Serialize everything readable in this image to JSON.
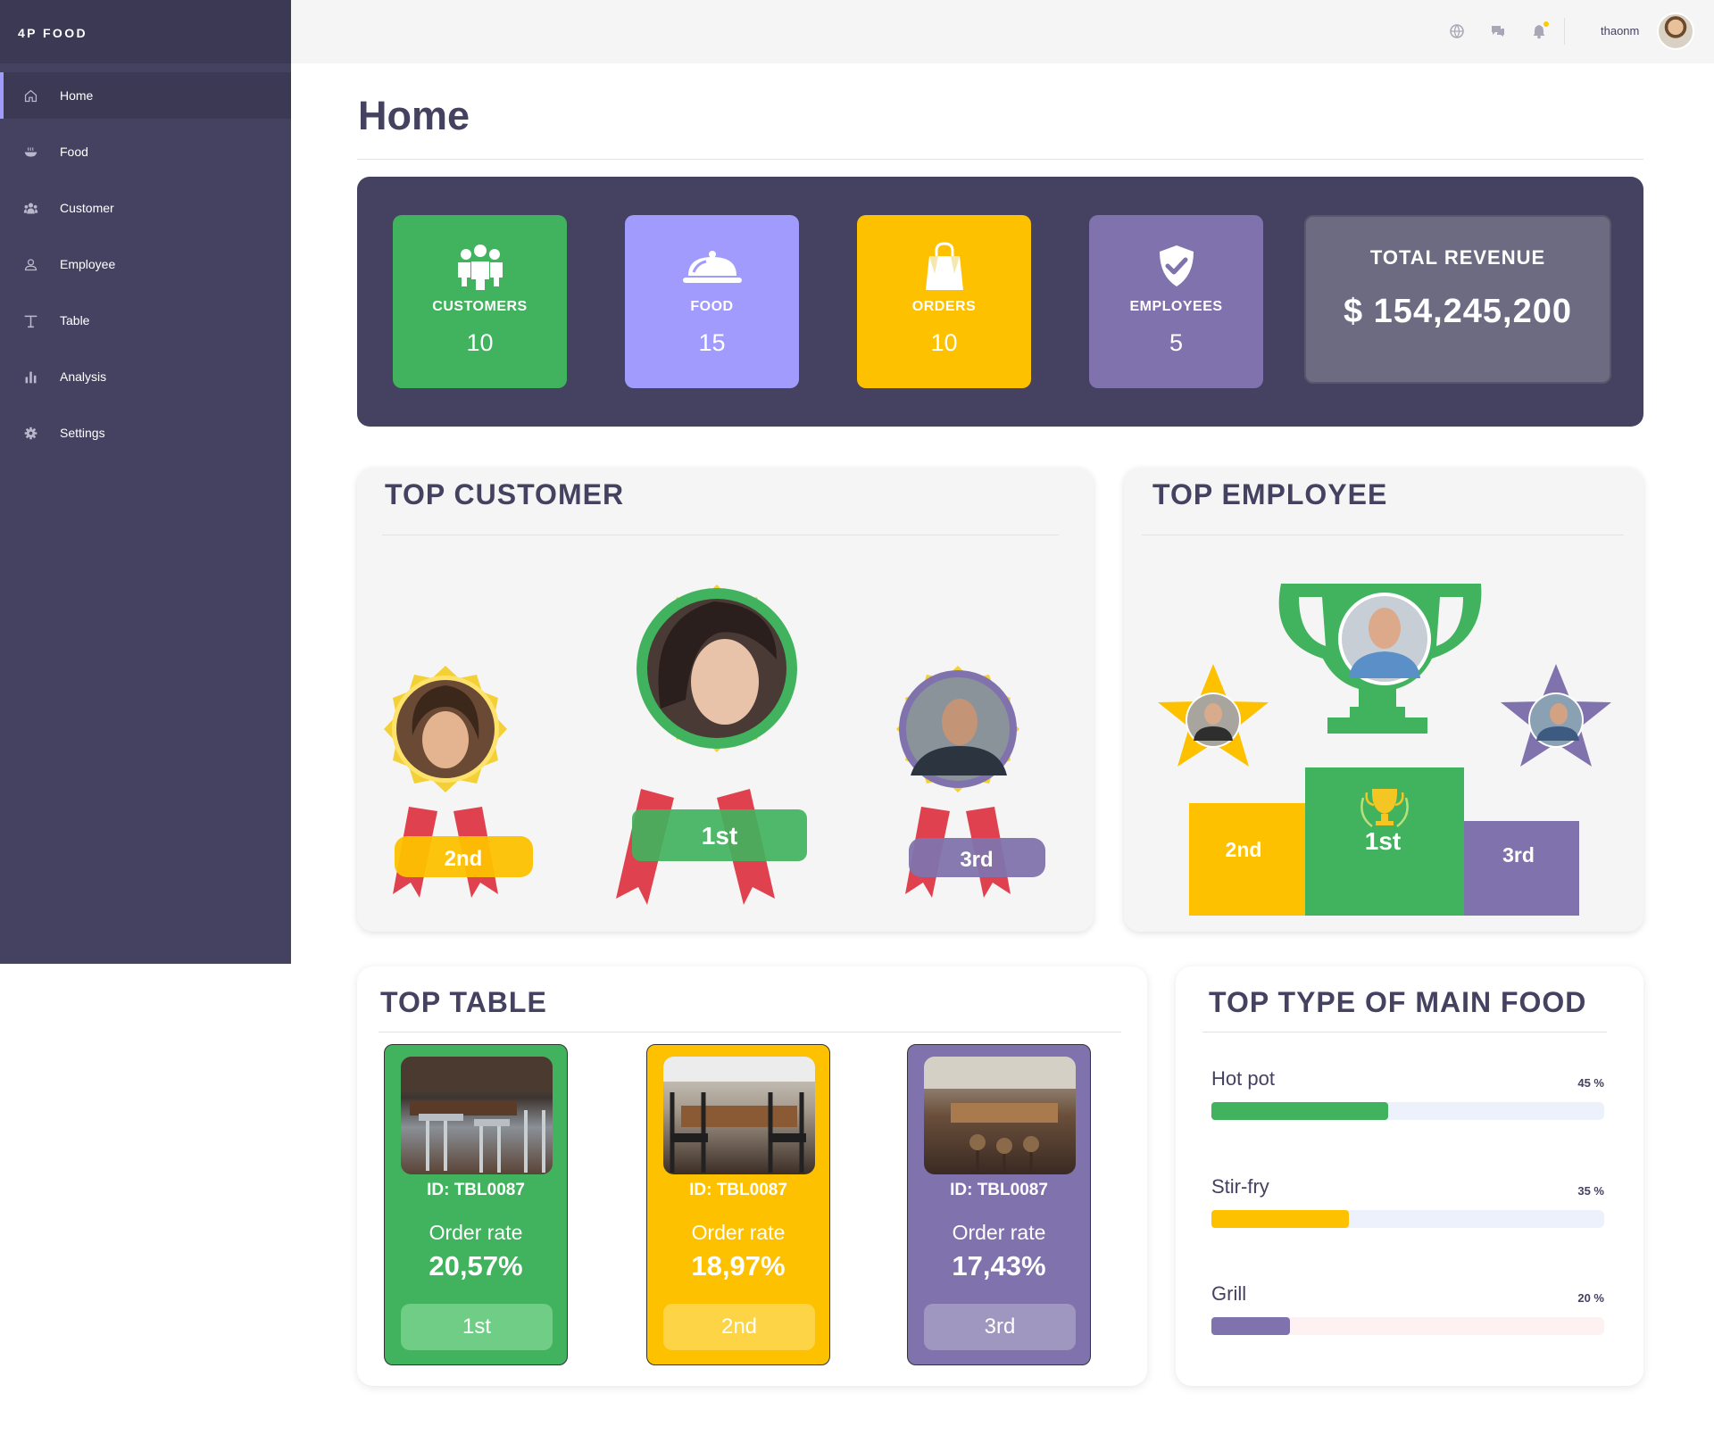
{
  "app": {
    "brand": "4P FOOD"
  },
  "sidebar": {
    "items": [
      {
        "label": "Home",
        "icon": "home-icon",
        "active": true
      },
      {
        "label": "Food",
        "icon": "bowl-icon"
      },
      {
        "label": "Customer",
        "icon": "users-icon"
      },
      {
        "label": "Employee",
        "icon": "user-icon"
      },
      {
        "label": "Table",
        "icon": "table-icon"
      },
      {
        "label": "Analysis",
        "icon": "bar-chart-icon"
      },
      {
        "label": "Settings",
        "icon": "gear-icon"
      }
    ]
  },
  "topbar": {
    "icons": [
      "globe-icon",
      "chat-icon",
      "bell-icon"
    ],
    "username": "thaonm"
  },
  "page": {
    "title": "Home"
  },
  "stats": {
    "customers": {
      "label": "CUSTOMERS",
      "value": "10",
      "icon": "users-icon",
      "color": "#41b25d"
    },
    "food": {
      "label": "FOOD",
      "value": "15",
      "icon": "cloche-icon",
      "color": "#a29bfe"
    },
    "orders": {
      "label": "ORDERS",
      "value": "10",
      "icon": "shopping-bag-icon",
      "color": "#fdc100"
    },
    "employees": {
      "label": "EMPLOYEES",
      "value": "5",
      "icon": "shield-check-icon",
      "color": "#8073ad"
    },
    "revenue": {
      "label": "TOTAL REVENUE",
      "value": "$ 154,245,200"
    }
  },
  "top_customer": {
    "title": "TOP CUSTOMER",
    "ranks": {
      "first": "1st",
      "second": "2nd",
      "third": "3rd"
    }
  },
  "top_employee": {
    "title": "TOP EMPLOYEE",
    "ranks": {
      "first": "1st",
      "second": "2nd",
      "third": "3rd"
    }
  },
  "top_table": {
    "title": "TOP TABLE",
    "cards": [
      {
        "id": "ID: TBL0087",
        "rate_label": "Order rate",
        "rate": "20,57%",
        "rank": "1st",
        "color": "#41b25d"
      },
      {
        "id": "ID: TBL0087",
        "rate_label": "Order rate",
        "rate": "18,97%",
        "rank": "2nd",
        "color": "#fdc100"
      },
      {
        "id": "ID: TBL0087",
        "rate_label": "Order rate",
        "rate": "17,43%",
        "rank": "3rd",
        "color": "#8073ad"
      }
    ]
  },
  "top_food": {
    "title": "TOP TYPE OF MAIN FOOD",
    "items": [
      {
        "name": "Hot pot",
        "pct_label": "45 %",
        "value": 0.45,
        "color": "#41b25d",
        "track": "#edf1fb"
      },
      {
        "name": "Stir-fry",
        "pct_label": "35 %",
        "value": 0.35,
        "color": "#fdc100",
        "track": "#edf1fb"
      },
      {
        "name": "Grill",
        "pct_label": "20 %",
        "value": 0.2,
        "color": "#8073ad",
        "track": "#fdf1f1"
      }
    ]
  }
}
